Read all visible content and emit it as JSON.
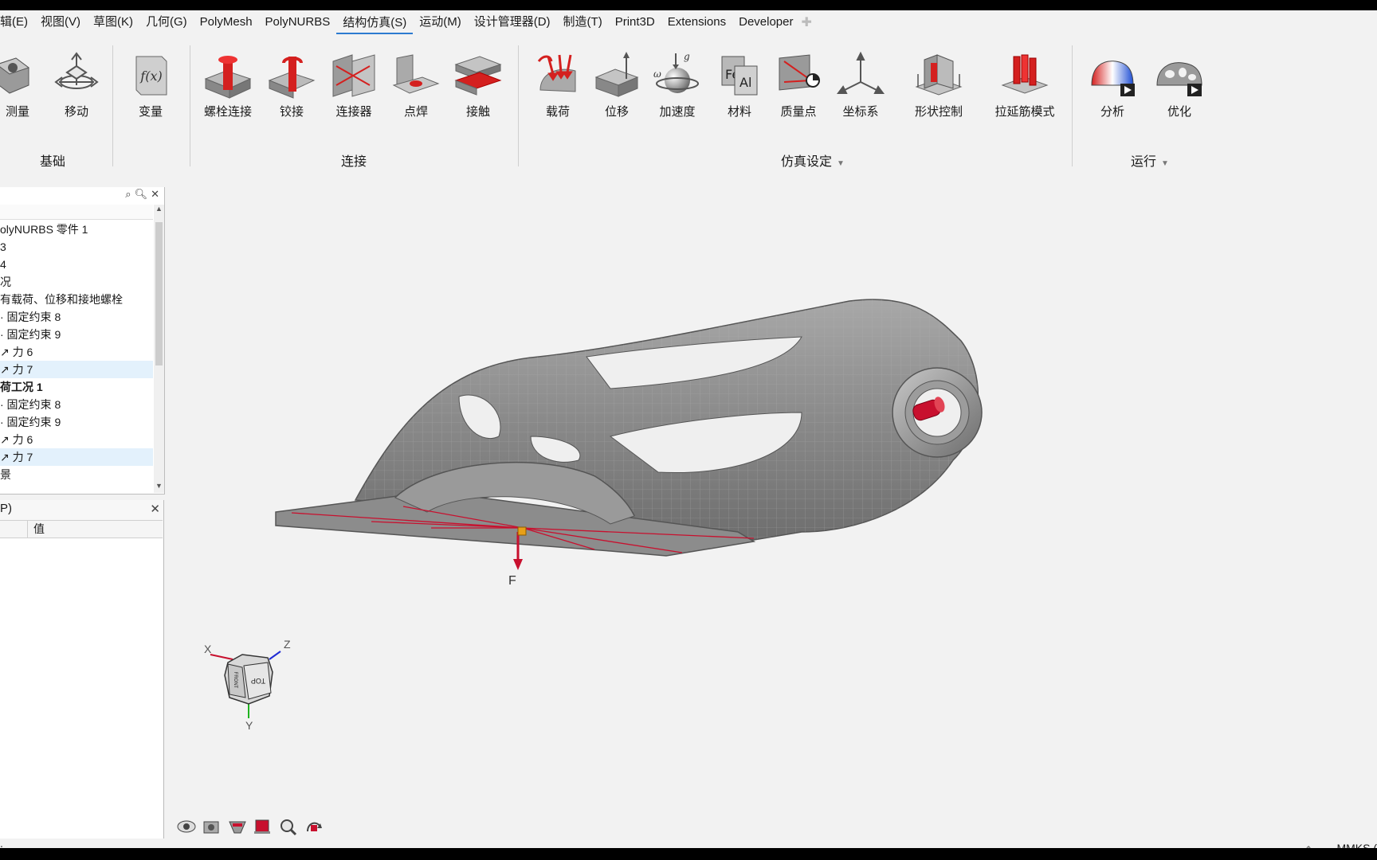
{
  "menubar": {
    "items": [
      "辑(E)",
      "视图(V)",
      "草图(K)",
      "几何(G)",
      "PolyMesh",
      "PolyNURBS",
      "结构仿真(S)",
      "运动(M)",
      "设计管理器(D)",
      "制造(T)",
      "Print3D",
      "Extensions",
      "Developer"
    ],
    "active_index": 6,
    "add_icon": "plus-icon"
  },
  "ribbon": {
    "groups": {
      "basic": "基础",
      "connect": "连接",
      "sim_setup": "仿真设定",
      "run": "运行"
    },
    "tools": {
      "measure": "测量",
      "move": "移动",
      "variable": "变量",
      "bolt": "螺栓连接",
      "hinge": "铰接",
      "connector": "连接器",
      "spot_weld": "点焊",
      "contact": "接触",
      "load": "载荷",
      "displacement": "位移",
      "acceleration": "加速度",
      "material": "材料",
      "mass_point": "质量点",
      "coord_system": "坐标系",
      "shape_control": "形状控制",
      "rib_mode": "拉延筋模式",
      "analyze": "分析",
      "optimize": "优化"
    }
  },
  "tree": {
    "rows": [
      {
        "text": "olyNURBS 零件 1",
        "bold": false,
        "selected": false
      },
      {
        "text": " 3",
        "bold": false,
        "selected": false
      },
      {
        "text": " 4",
        "bold": false,
        "selected": false
      },
      {
        "text": "况",
        "bold": false,
        "selected": false
      },
      {
        "text": "有载荷、位移和接地螺栓",
        "bold": false,
        "selected": false
      },
      {
        "text": "· 固定约束 8",
        "bold": false,
        "selected": false
      },
      {
        "text": "· 固定约束 9",
        "bold": false,
        "selected": false
      },
      {
        "text": "↗ 力 6",
        "bold": false,
        "selected": false
      },
      {
        "text": "↗ 力 7",
        "bold": false,
        "selected": true
      },
      {
        "text": "荷工况 1",
        "bold": true,
        "selected": false
      },
      {
        "text": "· 固定约束 8",
        "bold": false,
        "selected": false
      },
      {
        "text": "· 固定约束 9",
        "bold": false,
        "selected": false
      },
      {
        "text": "↗ 力 6",
        "bold": false,
        "selected": false
      },
      {
        "text": "↗ 力 7",
        "bold": false,
        "selected": true
      },
      {
        "text": "景",
        "bold": false,
        "selected": false
      }
    ]
  },
  "props": {
    "title": "P)",
    "value_header": "值"
  },
  "viewport": {
    "force_label": "F",
    "axes": {
      "x": "X",
      "y": "Y",
      "z": "Z"
    },
    "viewcube": {
      "face_front": "TOP",
      "face_side": "FRONT"
    },
    "colors": {
      "model": "#8e8e8e",
      "force": "#c8102e",
      "highlight": "#d4201f"
    }
  },
  "status": {
    "left": ":..",
    "units": "MMKS (",
    "snap_icon": "crosshair-icon"
  }
}
